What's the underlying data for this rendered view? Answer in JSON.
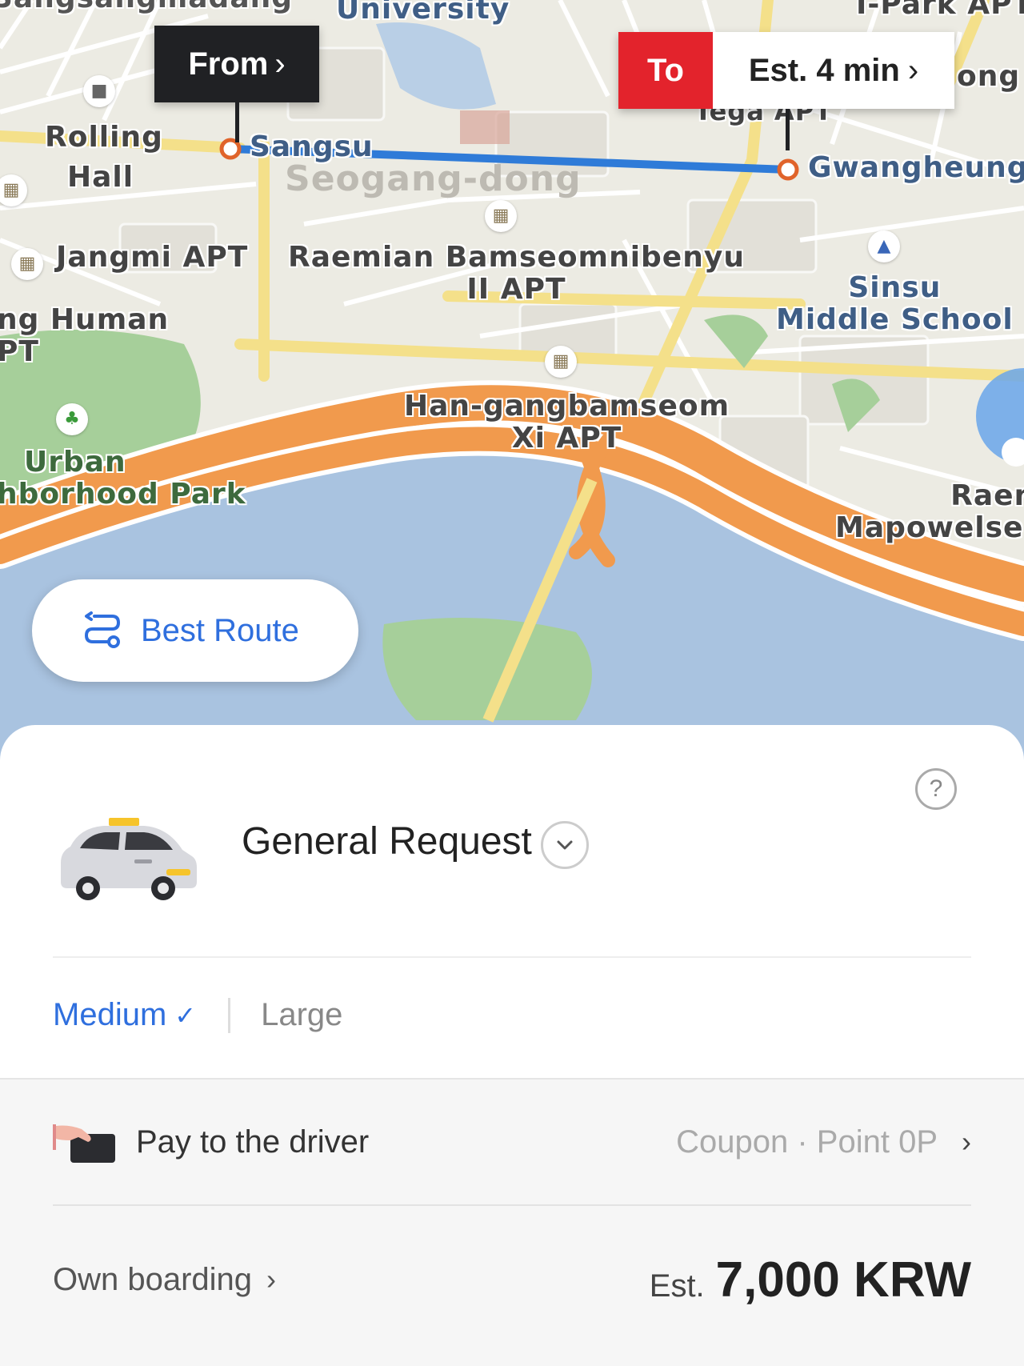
{
  "map": {
    "labels": {
      "top_left_cut": "Sangsangmadang",
      "university": "University",
      "ipark": "I-Park APT",
      "ong": "ong",
      "rolling_hall_1": "Rolling",
      "rolling_hall_2": "Hall",
      "sangsu": "Sangsu",
      "seogang_dong": "Seogang-dong",
      "tega": "Tega APT",
      "gwangheung": "Gwangheungch",
      "jangmi": "Jangmi APT",
      "raemian_1": "Raemian Bamseomnibenyu",
      "raemian_2": "II APT",
      "sinsu_1": "Sinsu",
      "sinsu_2": "Middle School",
      "human_1": "ng Human",
      "human_2": "PT",
      "hangang_1": "Han-gangbamseom",
      "hangang_2": "Xi APT",
      "urban_1": "Urban",
      "urban_2": "hborhood Park",
      "raem_1": "Raem",
      "raem_2": "Mapowelseu"
    },
    "from_flag": {
      "label": "From",
      "chevron": "›"
    },
    "to_flag": {
      "label": "To",
      "estimate": "Est. 4 min",
      "chevron": "›"
    },
    "best_route": {
      "label": "Best Route",
      "icon": "route-icon"
    },
    "colors": {
      "route": "#2f7bd8",
      "highway": "#f19a4d",
      "water": "#a9c3e0",
      "park": "#a6cf9a",
      "to_flag": "#e3232c",
      "from_flag": "#202124"
    }
  },
  "sheet": {
    "help_icon": "?",
    "request": {
      "title": "General Request",
      "icon": "taxi-icon"
    },
    "sizes": {
      "medium": "Medium",
      "medium_check": "✓",
      "large": "Large"
    },
    "payment": {
      "label": "Pay to the driver",
      "right": "Coupon · Point 0P",
      "chevron": "›"
    },
    "boarding": {
      "label": "Own boarding",
      "chevron": "›"
    },
    "fare": {
      "prefix": "Est.",
      "value": "7,000 KRW"
    },
    "accent_color": "#2f6fde"
  }
}
